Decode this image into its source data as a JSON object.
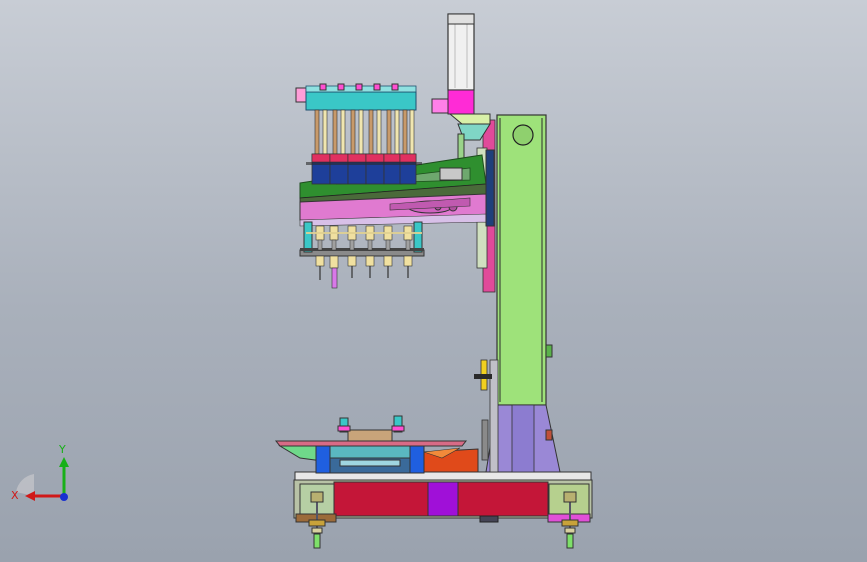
{
  "viewport": {
    "background_top": "#c8cdd5",
    "background_bottom": "#9aa2ae"
  },
  "triad": {
    "x_label": "X",
    "y_label": "Y",
    "x_color": "#d01818",
    "y_color": "#18b018",
    "z_color": "#1830d0"
  },
  "model": {
    "column_color": "#9ee27a",
    "column_base_color": "#9a88d6",
    "motor_color": "#e8e8e8",
    "motor_coupling_color": "#ff2bd6",
    "arm_top_color": "#2f8f2f",
    "arm_bottom_color": "#e07ad0",
    "base_color": "#c41638",
    "fixture_plate_color": "#d86b86",
    "accent_purple": "#a010d8",
    "accent_orange": "#e04a1a",
    "accent_blue": "#1f5fe0",
    "accent_cyan": "#3ac7c7",
    "spindle_count": 6
  }
}
